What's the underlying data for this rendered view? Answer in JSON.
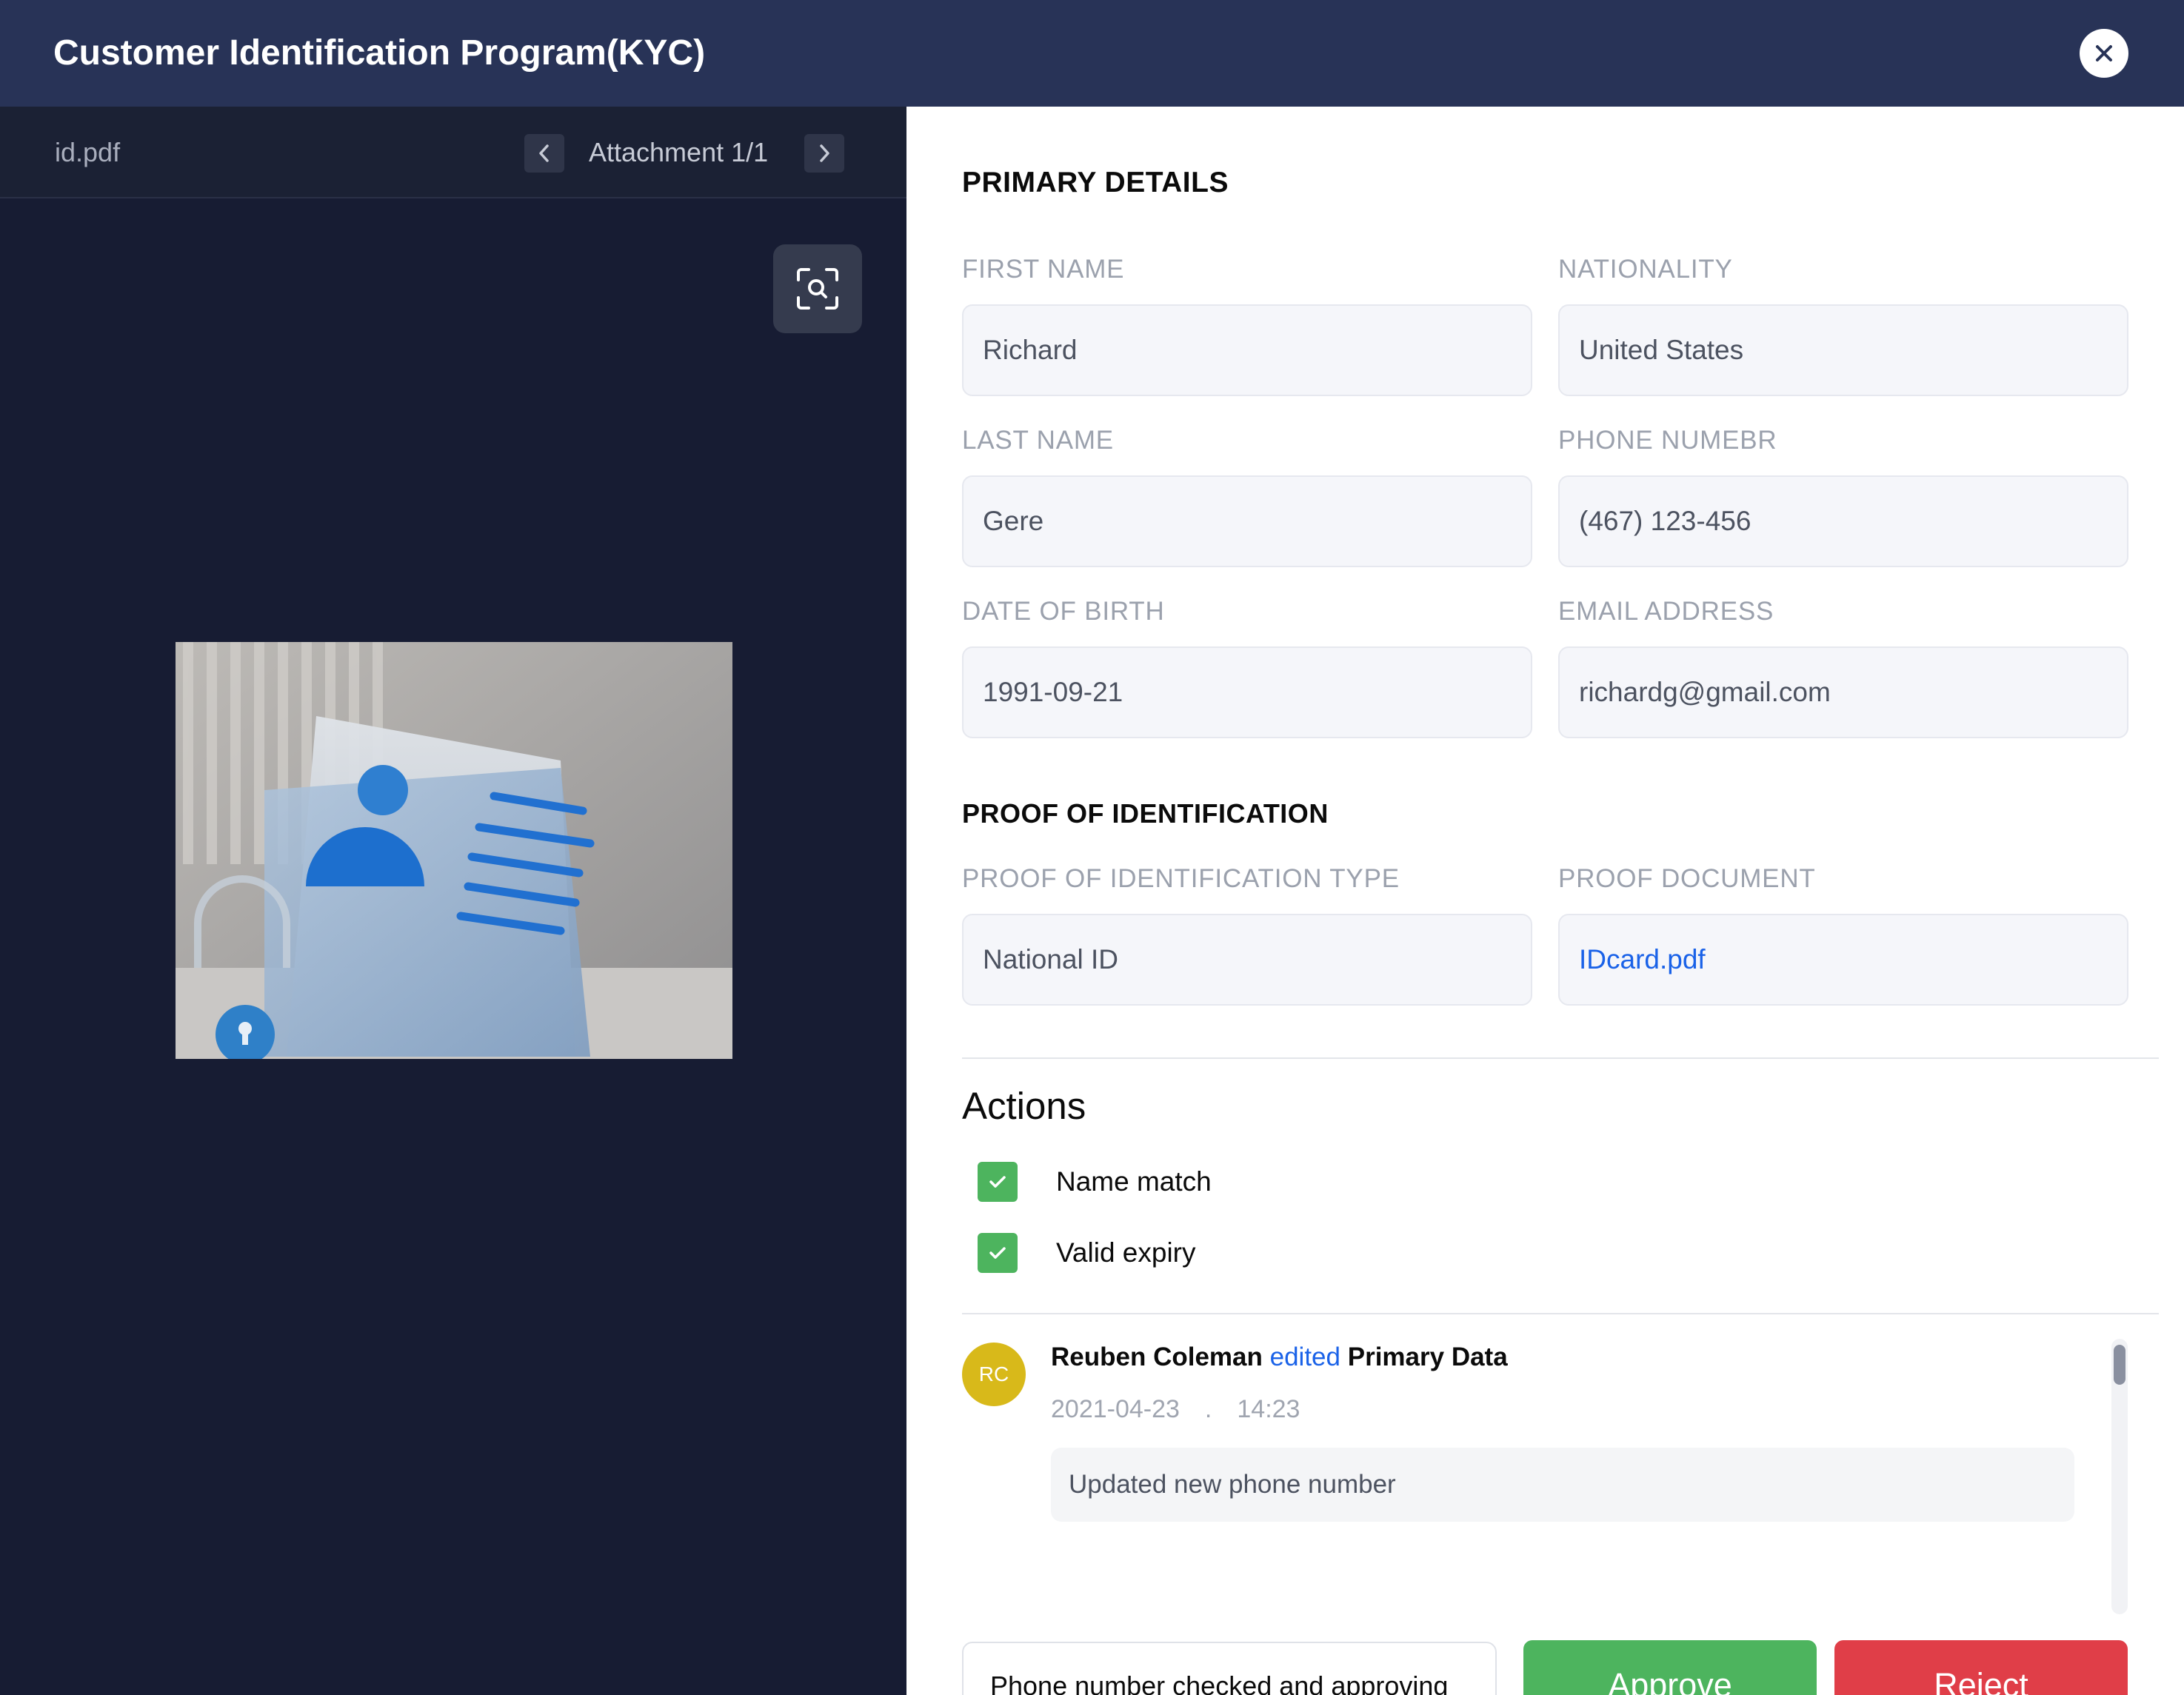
{
  "window": {
    "title": "Customer Identification Program(KYC)",
    "close_icon": "close-icon"
  },
  "viewer": {
    "file_name": "id.pdf",
    "attachment_label": "Attachment 1/1",
    "prev_icon": "chevron-left-icon",
    "next_icon": "chevron-right-icon",
    "zoom_icon": "zoom-scan-icon",
    "preview_image": "id-card-illustration"
  },
  "primary": {
    "title": "PRIMARY DETAILS",
    "first_name": {
      "label": "FIRST NAME",
      "value": "Richard"
    },
    "nationality": {
      "label": "NATIONALITY",
      "value": "United States"
    },
    "last_name": {
      "label": "LAST NAME",
      "value": "Gere"
    },
    "phone": {
      "label": "PHONE NUMEBR",
      "value": "(467) 123-456"
    },
    "dob": {
      "label": "DATE OF BIRTH",
      "value": "1991-09-21"
    },
    "email": {
      "label": "EMAIL ADDRESS",
      "value": "richardg@gmail.com"
    }
  },
  "proof": {
    "title": "PROOF OF IDENTIFICATION",
    "type": {
      "label": "PROOF OF IDENTIFICATION TYPE",
      "value": "National ID"
    },
    "document": {
      "label": "PROOF DOCUMENT",
      "value": "IDcard.pdf"
    }
  },
  "actions": {
    "title": "Actions",
    "checks": [
      {
        "label": "Name match",
        "checked": true
      },
      {
        "label": "Valid expiry",
        "checked": true
      }
    ]
  },
  "activity": {
    "initials": "RC",
    "user": "Reuben Coleman",
    "verb": "edited",
    "object": "Primary Data",
    "date": "2021-04-23",
    "separator": ".",
    "time": "14:23",
    "note": "Updated new phone number"
  },
  "footer": {
    "comment_value": "Phone number checked and approving",
    "approve_label": "Approve",
    "reject_label": "Reject"
  },
  "colors": {
    "header_bg": "#283357",
    "viewer_bg": "#171c33",
    "approve": "#4db45e",
    "reject": "#e03e48",
    "link": "#1a62e8",
    "avatar": "#d8b91a"
  }
}
